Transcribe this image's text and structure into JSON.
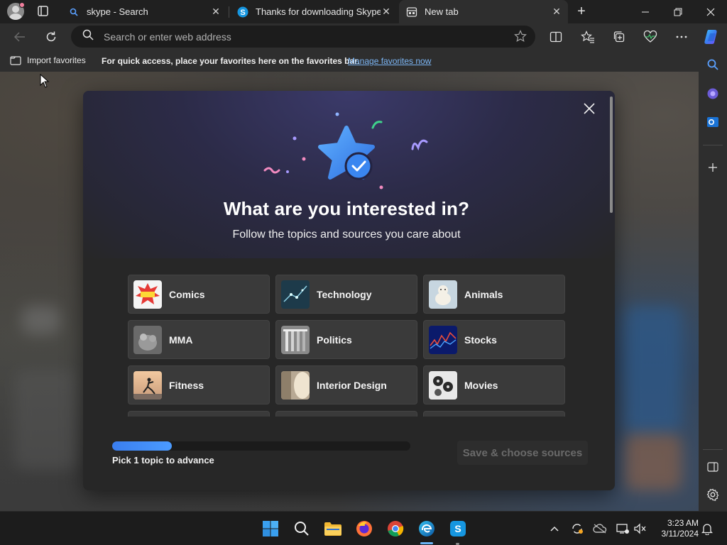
{
  "tabs": [
    {
      "title": "skype - Search",
      "icon": "search-icon"
    },
    {
      "title": "Thanks for downloading Skype",
      "icon": "skype-icon"
    },
    {
      "title": "New tab",
      "icon": "new-tab-page-icon"
    }
  ],
  "address_bar": {
    "placeholder": "Search or enter web address"
  },
  "favorites_bar": {
    "import_label": "Import favorites",
    "message": "For quick access, place your favorites here on the favorites bar.",
    "link": "Manage favorites now"
  },
  "modal": {
    "title": "What are you interested in?",
    "subtitle": "Follow the topics and sources you care about",
    "topics": [
      {
        "label": "Comics"
      },
      {
        "label": "Technology"
      },
      {
        "label": "Animals"
      },
      {
        "label": "MMA"
      },
      {
        "label": "Politics"
      },
      {
        "label": "Stocks"
      },
      {
        "label": "Fitness"
      },
      {
        "label": "Interior Design"
      },
      {
        "label": "Movies"
      }
    ],
    "progress_fraction": 0.2,
    "progress_text": "Pick 1 topic to advance",
    "save_button": "Save & choose sources"
  },
  "clock": {
    "time": "3:23 AM",
    "date": "3/11/2024"
  },
  "colors": {
    "accent": "#3a7ef0",
    "link": "#7cb6f5",
    "skype": "#1696e0"
  }
}
